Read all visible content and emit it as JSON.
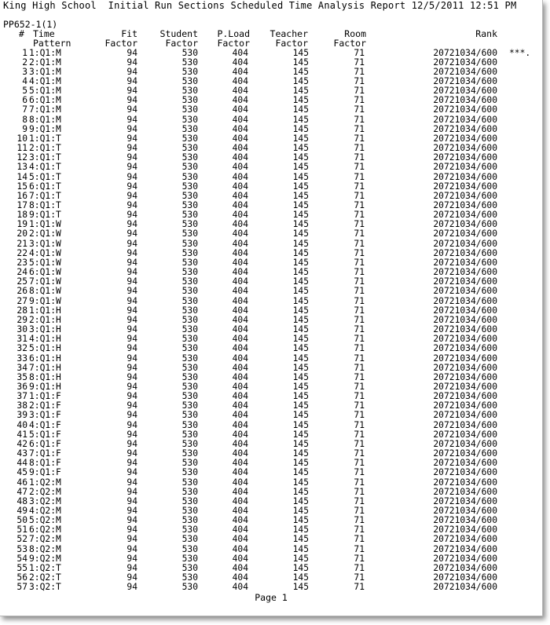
{
  "report": {
    "title": "King High School  Initial Run Sections Scheduled Time Analysis Report 12/5/2011 12:51 PM",
    "report_id": "PP652-1(1)",
    "page_label": "Page 1"
  },
  "headers": {
    "num": "#",
    "time_pattern": "Time\nPattern",
    "fit_factor": "Fit\nFactor",
    "student_factor": "Student\nFactor",
    "pload_factor": "P.Load\nFactor",
    "teacher_factor": "Teacher\nFactor",
    "room_factor": "Room\nFactor",
    "rank": "Rank"
  },
  "rows": [
    {
      "num": "1",
      "pattern": "1:Q1:M",
      "fit": "94",
      "student": "530",
      "pload": "404",
      "teacher": "145",
      "room": "71",
      "rank": "20721034/600",
      "mark": "***."
    },
    {
      "num": "2",
      "pattern": "2:Q1:M",
      "fit": "94",
      "student": "530",
      "pload": "404",
      "teacher": "145",
      "room": "71",
      "rank": "20721034/600",
      "mark": ""
    },
    {
      "num": "3",
      "pattern": "3:Q1:M",
      "fit": "94",
      "student": "530",
      "pload": "404",
      "teacher": "145",
      "room": "71",
      "rank": "20721034/600",
      "mark": ""
    },
    {
      "num": "4",
      "pattern": "4:Q1:M",
      "fit": "94",
      "student": "530",
      "pload": "404",
      "teacher": "145",
      "room": "71",
      "rank": "20721034/600",
      "mark": ""
    },
    {
      "num": "5",
      "pattern": "5:Q1:M",
      "fit": "94",
      "student": "530",
      "pload": "404",
      "teacher": "145",
      "room": "71",
      "rank": "20721034/600",
      "mark": ""
    },
    {
      "num": "6",
      "pattern": "6:Q1:M",
      "fit": "94",
      "student": "530",
      "pload": "404",
      "teacher": "145",
      "room": "71",
      "rank": "20721034/600",
      "mark": ""
    },
    {
      "num": "7",
      "pattern": "7:Q1:M",
      "fit": "94",
      "student": "530",
      "pload": "404",
      "teacher": "145",
      "room": "71",
      "rank": "20721034/600",
      "mark": ""
    },
    {
      "num": "8",
      "pattern": "8:Q1:M",
      "fit": "94",
      "student": "530",
      "pload": "404",
      "teacher": "145",
      "room": "71",
      "rank": "20721034/600",
      "mark": ""
    },
    {
      "num": "9",
      "pattern": "9:Q1:M",
      "fit": "94",
      "student": "530",
      "pload": "404",
      "teacher": "145",
      "room": "71",
      "rank": "20721034/600",
      "mark": ""
    },
    {
      "num": "10",
      "pattern": "1:Q1:T",
      "fit": "94",
      "student": "530",
      "pload": "404",
      "teacher": "145",
      "room": "71",
      "rank": "20721034/600",
      "mark": ""
    },
    {
      "num": "11",
      "pattern": "2:Q1:T",
      "fit": "94",
      "student": "530",
      "pload": "404",
      "teacher": "145",
      "room": "71",
      "rank": "20721034/600",
      "mark": ""
    },
    {
      "num": "12",
      "pattern": "3:Q1:T",
      "fit": "94",
      "student": "530",
      "pload": "404",
      "teacher": "145",
      "room": "71",
      "rank": "20721034/600",
      "mark": ""
    },
    {
      "num": "13",
      "pattern": "4:Q1:T",
      "fit": "94",
      "student": "530",
      "pload": "404",
      "teacher": "145",
      "room": "71",
      "rank": "20721034/600",
      "mark": ""
    },
    {
      "num": "14",
      "pattern": "5:Q1:T",
      "fit": "94",
      "student": "530",
      "pload": "404",
      "teacher": "145",
      "room": "71",
      "rank": "20721034/600",
      "mark": ""
    },
    {
      "num": "15",
      "pattern": "6:Q1:T",
      "fit": "94",
      "student": "530",
      "pload": "404",
      "teacher": "145",
      "room": "71",
      "rank": "20721034/600",
      "mark": ""
    },
    {
      "num": "16",
      "pattern": "7:Q1:T",
      "fit": "94",
      "student": "530",
      "pload": "404",
      "teacher": "145",
      "room": "71",
      "rank": "20721034/600",
      "mark": ""
    },
    {
      "num": "17",
      "pattern": "8:Q1:T",
      "fit": "94",
      "student": "530",
      "pload": "404",
      "teacher": "145",
      "room": "71",
      "rank": "20721034/600",
      "mark": ""
    },
    {
      "num": "18",
      "pattern": "9:Q1:T",
      "fit": "94",
      "student": "530",
      "pload": "404",
      "teacher": "145",
      "room": "71",
      "rank": "20721034/600",
      "mark": ""
    },
    {
      "num": "19",
      "pattern": "1:Q1:W",
      "fit": "94",
      "student": "530",
      "pload": "404",
      "teacher": "145",
      "room": "71",
      "rank": "20721034/600",
      "mark": ""
    },
    {
      "num": "20",
      "pattern": "2:Q1:W",
      "fit": "94",
      "student": "530",
      "pload": "404",
      "teacher": "145",
      "room": "71",
      "rank": "20721034/600",
      "mark": ""
    },
    {
      "num": "21",
      "pattern": "3:Q1:W",
      "fit": "94",
      "student": "530",
      "pload": "404",
      "teacher": "145",
      "room": "71",
      "rank": "20721034/600",
      "mark": ""
    },
    {
      "num": "22",
      "pattern": "4:Q1:W",
      "fit": "94",
      "student": "530",
      "pload": "404",
      "teacher": "145",
      "room": "71",
      "rank": "20721034/600",
      "mark": ""
    },
    {
      "num": "23",
      "pattern": "5:Q1:W",
      "fit": "94",
      "student": "530",
      "pload": "404",
      "teacher": "145",
      "room": "71",
      "rank": "20721034/600",
      "mark": ""
    },
    {
      "num": "24",
      "pattern": "6:Q1:W",
      "fit": "94",
      "student": "530",
      "pload": "404",
      "teacher": "145",
      "room": "71",
      "rank": "20721034/600",
      "mark": ""
    },
    {
      "num": "25",
      "pattern": "7:Q1:W",
      "fit": "94",
      "student": "530",
      "pload": "404",
      "teacher": "145",
      "room": "71",
      "rank": "20721034/600",
      "mark": ""
    },
    {
      "num": "26",
      "pattern": "8:Q1:W",
      "fit": "94",
      "student": "530",
      "pload": "404",
      "teacher": "145",
      "room": "71",
      "rank": "20721034/600",
      "mark": ""
    },
    {
      "num": "27",
      "pattern": "9:Q1:W",
      "fit": "94",
      "student": "530",
      "pload": "404",
      "teacher": "145",
      "room": "71",
      "rank": "20721034/600",
      "mark": ""
    },
    {
      "num": "28",
      "pattern": "1:Q1:H",
      "fit": "94",
      "student": "530",
      "pload": "404",
      "teacher": "145",
      "room": "71",
      "rank": "20721034/600",
      "mark": ""
    },
    {
      "num": "29",
      "pattern": "2:Q1:H",
      "fit": "94",
      "student": "530",
      "pload": "404",
      "teacher": "145",
      "room": "71",
      "rank": "20721034/600",
      "mark": ""
    },
    {
      "num": "30",
      "pattern": "3:Q1:H",
      "fit": "94",
      "student": "530",
      "pload": "404",
      "teacher": "145",
      "room": "71",
      "rank": "20721034/600",
      "mark": ""
    },
    {
      "num": "31",
      "pattern": "4:Q1:H",
      "fit": "94",
      "student": "530",
      "pload": "404",
      "teacher": "145",
      "room": "71",
      "rank": "20721034/600",
      "mark": ""
    },
    {
      "num": "32",
      "pattern": "5:Q1:H",
      "fit": "94",
      "student": "530",
      "pload": "404",
      "teacher": "145",
      "room": "71",
      "rank": "20721034/600",
      "mark": ""
    },
    {
      "num": "33",
      "pattern": "6:Q1:H",
      "fit": "94",
      "student": "530",
      "pload": "404",
      "teacher": "145",
      "room": "71",
      "rank": "20721034/600",
      "mark": ""
    },
    {
      "num": "34",
      "pattern": "7:Q1:H",
      "fit": "94",
      "student": "530",
      "pload": "404",
      "teacher": "145",
      "room": "71",
      "rank": "20721034/600",
      "mark": ""
    },
    {
      "num": "35",
      "pattern": "8:Q1:H",
      "fit": "94",
      "student": "530",
      "pload": "404",
      "teacher": "145",
      "room": "71",
      "rank": "20721034/600",
      "mark": ""
    },
    {
      "num": "36",
      "pattern": "9:Q1:H",
      "fit": "94",
      "student": "530",
      "pload": "404",
      "teacher": "145",
      "room": "71",
      "rank": "20721034/600",
      "mark": ""
    },
    {
      "num": "37",
      "pattern": "1:Q1:F",
      "fit": "94",
      "student": "530",
      "pload": "404",
      "teacher": "145",
      "room": "71",
      "rank": "20721034/600",
      "mark": ""
    },
    {
      "num": "38",
      "pattern": "2:Q1:F",
      "fit": "94",
      "student": "530",
      "pload": "404",
      "teacher": "145",
      "room": "71",
      "rank": "20721034/600",
      "mark": ""
    },
    {
      "num": "39",
      "pattern": "3:Q1:F",
      "fit": "94",
      "student": "530",
      "pload": "404",
      "teacher": "145",
      "room": "71",
      "rank": "20721034/600",
      "mark": ""
    },
    {
      "num": "40",
      "pattern": "4:Q1:F",
      "fit": "94",
      "student": "530",
      "pload": "404",
      "teacher": "145",
      "room": "71",
      "rank": "20721034/600",
      "mark": ""
    },
    {
      "num": "41",
      "pattern": "5:Q1:F",
      "fit": "94",
      "student": "530",
      "pload": "404",
      "teacher": "145",
      "room": "71",
      "rank": "20721034/600",
      "mark": ""
    },
    {
      "num": "42",
      "pattern": "6:Q1:F",
      "fit": "94",
      "student": "530",
      "pload": "404",
      "teacher": "145",
      "room": "71",
      "rank": "20721034/600",
      "mark": ""
    },
    {
      "num": "43",
      "pattern": "7:Q1:F",
      "fit": "94",
      "student": "530",
      "pload": "404",
      "teacher": "145",
      "room": "71",
      "rank": "20721034/600",
      "mark": ""
    },
    {
      "num": "44",
      "pattern": "8:Q1:F",
      "fit": "94",
      "student": "530",
      "pload": "404",
      "teacher": "145",
      "room": "71",
      "rank": "20721034/600",
      "mark": ""
    },
    {
      "num": "45",
      "pattern": "9:Q1:F",
      "fit": "94",
      "student": "530",
      "pload": "404",
      "teacher": "145",
      "room": "71",
      "rank": "20721034/600",
      "mark": ""
    },
    {
      "num": "46",
      "pattern": "1:Q2:M",
      "fit": "94",
      "student": "530",
      "pload": "404",
      "teacher": "145",
      "room": "71",
      "rank": "20721034/600",
      "mark": ""
    },
    {
      "num": "47",
      "pattern": "2:Q2:M",
      "fit": "94",
      "student": "530",
      "pload": "404",
      "teacher": "145",
      "room": "71",
      "rank": "20721034/600",
      "mark": ""
    },
    {
      "num": "48",
      "pattern": "3:Q2:M",
      "fit": "94",
      "student": "530",
      "pload": "404",
      "teacher": "145",
      "room": "71",
      "rank": "20721034/600",
      "mark": ""
    },
    {
      "num": "49",
      "pattern": "4:Q2:M",
      "fit": "94",
      "student": "530",
      "pload": "404",
      "teacher": "145",
      "room": "71",
      "rank": "20721034/600",
      "mark": ""
    },
    {
      "num": "50",
      "pattern": "5:Q2:M",
      "fit": "94",
      "student": "530",
      "pload": "404",
      "teacher": "145",
      "room": "71",
      "rank": "20721034/600",
      "mark": ""
    },
    {
      "num": "51",
      "pattern": "6:Q2:M",
      "fit": "94",
      "student": "530",
      "pload": "404",
      "teacher": "145",
      "room": "71",
      "rank": "20721034/600",
      "mark": ""
    },
    {
      "num": "52",
      "pattern": "7:Q2:M",
      "fit": "94",
      "student": "530",
      "pload": "404",
      "teacher": "145",
      "room": "71",
      "rank": "20721034/600",
      "mark": ""
    },
    {
      "num": "53",
      "pattern": "8:Q2:M",
      "fit": "94",
      "student": "530",
      "pload": "404",
      "teacher": "145",
      "room": "71",
      "rank": "20721034/600",
      "mark": ""
    },
    {
      "num": "54",
      "pattern": "9:Q2:M",
      "fit": "94",
      "student": "530",
      "pload": "404",
      "teacher": "145",
      "room": "71",
      "rank": "20721034/600",
      "mark": ""
    },
    {
      "num": "55",
      "pattern": "1:Q2:T",
      "fit": "94",
      "student": "530",
      "pload": "404",
      "teacher": "145",
      "room": "71",
      "rank": "20721034/600",
      "mark": ""
    },
    {
      "num": "56",
      "pattern": "2:Q2:T",
      "fit": "94",
      "student": "530",
      "pload": "404",
      "teacher": "145",
      "room": "71",
      "rank": "20721034/600",
      "mark": ""
    },
    {
      "num": "57",
      "pattern": "3:Q2:T",
      "fit": "94",
      "student": "530",
      "pload": "404",
      "teacher": "145",
      "room": "71",
      "rank": "20721034/600",
      "mark": ""
    }
  ]
}
